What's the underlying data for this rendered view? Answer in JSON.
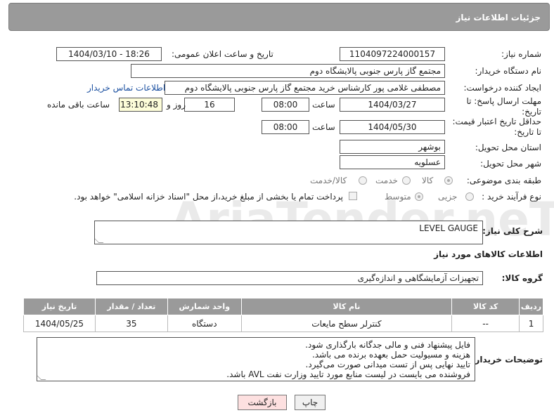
{
  "header": {
    "title": "جزئیات اطلاعات نیاز"
  },
  "form": {
    "need_number_label": "شماره نیاز:",
    "need_number": "1104097224000157",
    "announce_label": "تاریخ و ساعت اعلان عمومی:",
    "announce_value": "1404/03/10 - 18:26",
    "buyer_org_label": "نام دستگاه خریدار:",
    "buyer_org": "مجتمع گاز پارس جنوبی  پالایشگاه دوم",
    "creator_label": "ایجاد کننده درخواست:",
    "creator": "مصطفی غلامی پور کارشناس خرید مجتمع گاز پارس جنوبی  پالایشگاه دوم",
    "buyer_contact_link": "اطلاعات تماس خریدار",
    "deadline_label": "مهلت ارسال پاسخ: تا تاریخ:",
    "deadline_date": "1404/03/27",
    "time_label": "ساعت",
    "deadline_time": "08:00",
    "days_value": "16",
    "days_label": "روز و",
    "remaining_time": "13:10:48",
    "remaining_label": "ساعت باقی مانده",
    "price_validity_label": "حداقل تاریخ اعتبار قیمت: تا تاریخ:",
    "price_validity_date": "1404/05/30",
    "price_validity_time": "08:00",
    "province_label": "استان محل تحویل:",
    "province": "بوشهر",
    "city_label": "شهر محل تحویل:",
    "city": "عسلویه",
    "category_label": "طبقه بندی موضوعی:",
    "category_options": [
      "کالا",
      "خدمت",
      "کالا/خدمت"
    ],
    "category_selected": "کالا",
    "process_label": "نوع فرآیند خرید :",
    "process_options": [
      "جزیی",
      "متوسط"
    ],
    "process_selected": "متوسط",
    "payment_note": "پرداخت تمام یا بخشی از مبلغ خرید،از محل \"اسناد خزانه اسلامی\" خواهد بود."
  },
  "description": {
    "label": "شرح کلی نیاز:",
    "value": "LEVEL GAUGE"
  },
  "goods_section": {
    "title": "اطلاعات کالاهای مورد نیاز",
    "group_label": "گروه کالا:",
    "group_value": "تجهیزات آزمایشگاهی و اندازه‌گیری",
    "columns": [
      "ردیف",
      "کد کالا",
      "نام کالا",
      "واحد شمارش",
      "تعداد / مقدار",
      "تاریخ نیاز"
    ],
    "rows": [
      [
        "1",
        "--",
        "کنترلر سطح مایعات",
        "دستگاه",
        "35",
        "1404/05/25"
      ]
    ]
  },
  "buyer_notes": {
    "label": "توضیحات خریدار:",
    "lines": [
      "فایل پیشنهاد فنی و مالی جدگانه بارگذاری شود.",
      "هزینه و مسیولیت حمل بعهده برنده می باشد.",
      "تایید نهایی پس از تست میدانی صورت می‌گیرد.",
      "فروشنده می بایست در لیست منابع مورد تایید وزارت نفت AVL باشد."
    ]
  },
  "buttons": {
    "print": "چاپ",
    "back": "بازگشت"
  },
  "watermark": {
    "text": "AriaTender.neT"
  }
}
